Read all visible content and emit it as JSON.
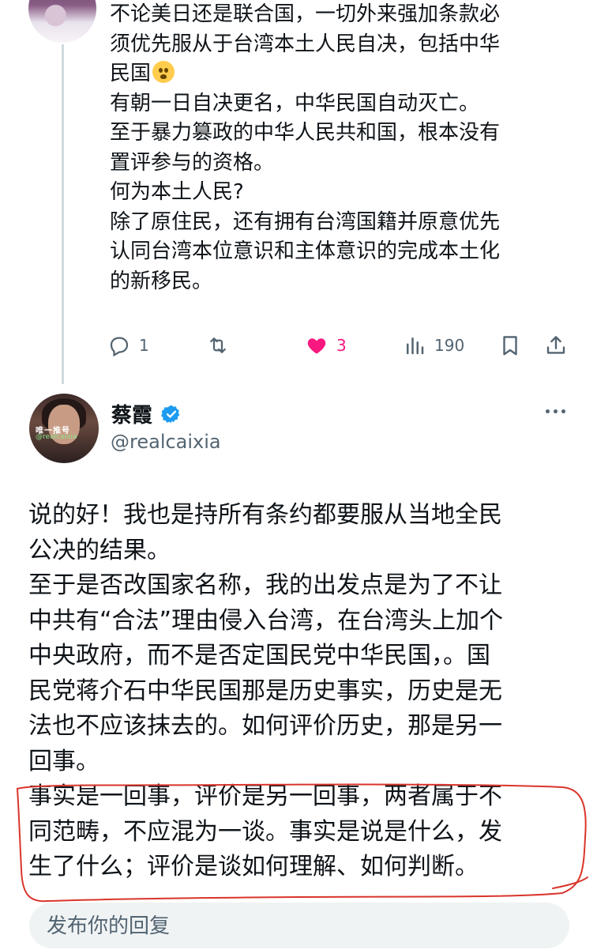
{
  "parent_tweet": {
    "lines": [
      "不论美日还是联合国，一切外来强加条款必",
      "须优先服从于台湾本土人民自决，包括中华",
      "民国",
      "有朝一日自决更名，中华民国自动灭亡。",
      "至于暴力篡政的中华人民共和国，根本没有",
      "置评参与的资格。",
      "何为本土人民?",
      "除了原住民，还有拥有台湾国籍并原意优先",
      "认同台湾本位意识和主体意识的完成本土化",
      "的新移民。"
    ],
    "emoji": "anguished-face-emoji",
    "actions": {
      "replies": "1",
      "retweets": "",
      "likes": "3",
      "views": "190"
    }
  },
  "reply_tweet": {
    "author_name": "蔡霞",
    "handle": "@realcaixia",
    "avatar_text_1": "唯一推号",
    "avatar_text_2": "@realcaixia",
    "lines": [
      "说的好！我也是持所有条约都要服从当地全民",
      "公决的结果。",
      "至于是否改国家名称，我的出发点是为了不让",
      "中共有“合法”理由侵入台湾，在台湾头上加个",
      "中央政府，而不是否定国民党中华民国，。国",
      "民党蒋介石中华民国那是历史事实，历史是无",
      "法也不应该抹去的。如何评价历史，那是另一",
      "回事。",
      "事实是一回事，评价是另一回事，两者属于不",
      "同范畴，不应混为一谈。事实是说是什么，发",
      "生了什么；评价是谈如何理解、如何判断。"
    ]
  },
  "reply_box": {
    "placeholder": "发布你的回复"
  },
  "colors": {
    "text": "#0f1419",
    "secondary": "#536471",
    "like": "#f91880",
    "verified": "#1d9bf0",
    "annotation": "#d9352b"
  }
}
